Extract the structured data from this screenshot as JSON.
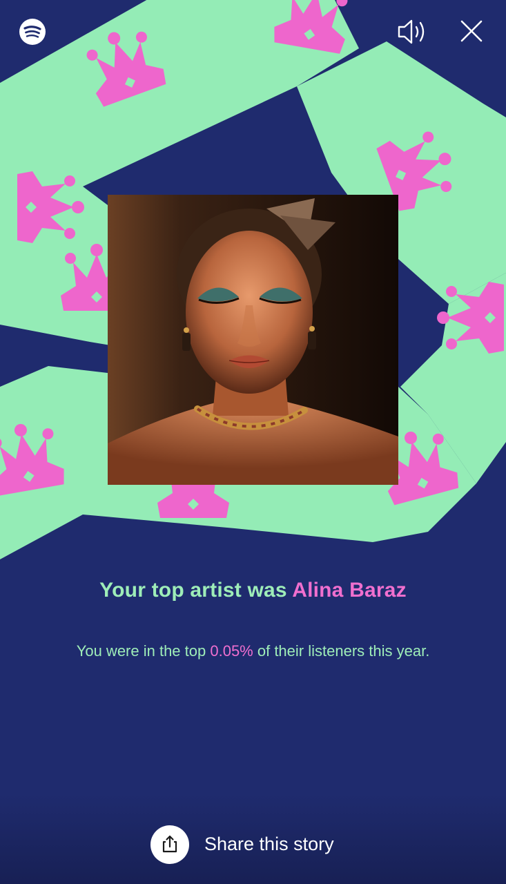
{
  "colors": {
    "background": "#1f2b6e",
    "ribbon": "#94ecb6",
    "crown": "#ee66cc",
    "text_primary": "#9eedb8",
    "text_accent": "#f06fcf",
    "share_text": "#ffffff"
  },
  "header": {
    "logo_icon": "spotify-logo-icon",
    "sound_icon": "speaker-icon",
    "close_icon": "close-icon"
  },
  "story": {
    "headline_prefix": "Your top artist was ",
    "artist_name": "Alina Baraz",
    "subline_prefix": "You were in the top ",
    "percentile": "0.05%",
    "subline_suffix": " of their listeners this year."
  },
  "footer": {
    "share_icon": "share-icon",
    "share_label": "Share this story"
  }
}
